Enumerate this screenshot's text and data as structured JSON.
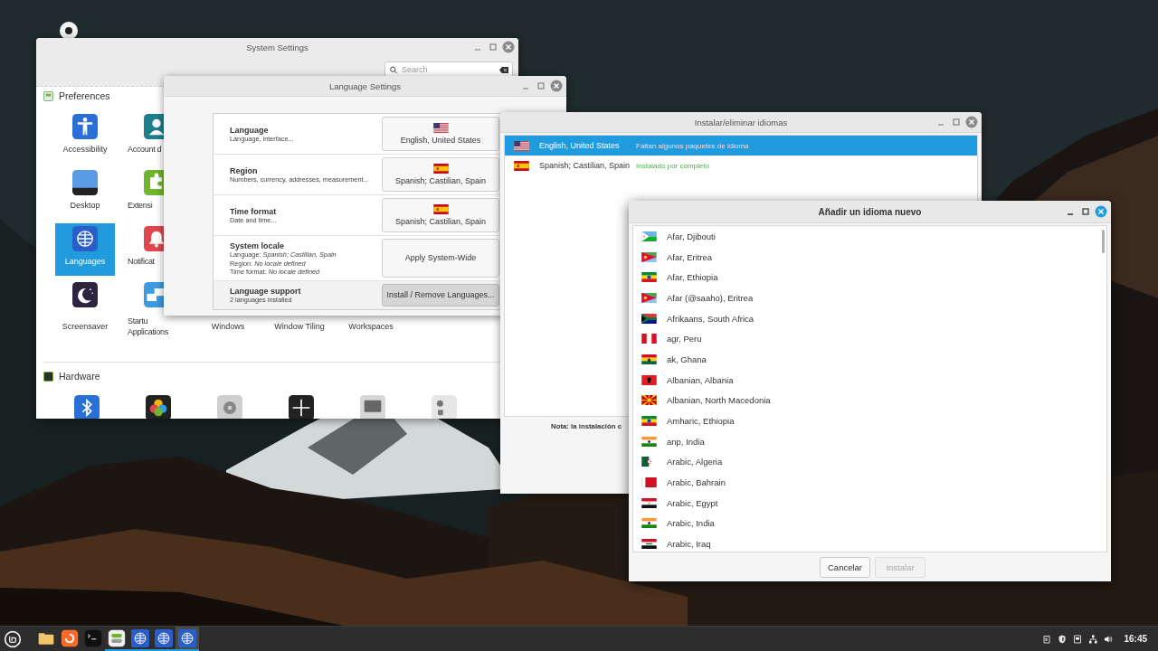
{
  "system_settings": {
    "title": "System Settings",
    "search": {
      "placeholder": "Search"
    },
    "sections": [
      {
        "title": "Preferences",
        "rows": [
          [
            {
              "label": "Accessibility",
              "selected": false,
              "clipped": false
            },
            {
              "label": "Account d",
              "selected": false,
              "clipped": true
            }
          ],
          [
            {
              "label": "Desktop",
              "selected": false,
              "clipped": false
            },
            {
              "label": "Extensi",
              "selected": false,
              "clipped": true
            }
          ],
          [
            {
              "label": "Languages",
              "selected": true,
              "clipped": false
            },
            {
              "label": "Notificat",
              "selected": false,
              "clipped": true
            }
          ],
          [
            {
              "label": "Screensaver",
              "selected": false,
              "clipped": false
            },
            {
              "label": "Startu Applications",
              "selected": false,
              "clipped": true
            },
            {
              "label": "Windows",
              "selected": false,
              "clipped": false
            },
            {
              "label": "Window Tiling",
              "selected": false,
              "clipped": false
            },
            {
              "label": "Workspaces",
              "selected": false,
              "clipped": false
            }
          ]
        ]
      },
      {
        "title": "Hardware"
      }
    ]
  },
  "language_settings": {
    "title": "Language Settings",
    "rows": [
      {
        "label": "Language",
        "description": [
          "Language, interface..."
        ],
        "button": {
          "label": "English, United States",
          "pressed": false
        }
      },
      {
        "label": "Region",
        "description": [
          "Numbers, currency, addresses, measurement..."
        ],
        "button": {
          "label": "Spanish; Castilian, Spain",
          "pressed": false
        }
      },
      {
        "label": "Time format",
        "description": [
          "Date and time..."
        ],
        "button": {
          "label": "Spanish; Castilian, Spain",
          "pressed": false
        }
      },
      {
        "label": "System locale",
        "description": [
          "Language: *Spanish; Castilian, Spain*",
          "Region: *No locale defined*",
          "Time format: *No locale defined*"
        ],
        "button": {
          "label": "Apply System-Wide",
          "pressed": false
        }
      },
      {
        "label": "Language support",
        "description": [
          "2 languages installed"
        ],
        "button": {
          "label": "Install / Remove Languages...",
          "pressed": true
        }
      }
    ]
  },
  "install_remove": {
    "title": "Instalar/eliminar idiomas",
    "languages": [
      {
        "name": "English, United States",
        "status": {
          "text": "Faltan algunos paquetes de idioma",
          "kind": "missing"
        },
        "selected": true
      },
      {
        "name": "Spanish; Castilian, Spain",
        "status": {
          "text": "Instalado por completo",
          "kind": "complete"
        },
        "selected": false
      }
    ],
    "note": "Nota: la instalación c"
  },
  "add_language": {
    "title": "Añadir un idioma nuevo",
    "languages": [
      "Afar, Djibouti",
      "Afar, Eritrea",
      "Afar, Ethiopia",
      "Afar (@saaho), Eritrea",
      "Afrikaans, South Africa",
      "agr, Peru",
      "ak, Ghana",
      "Albanian, Albania",
      "Albanian, North Macedonia",
      "Amharic, Ethiopia",
      "anp, India",
      "Arabic, Algeria",
      "Arabic, Bahrain",
      "Arabic, Egypt",
      "Arabic, India",
      "Arabic, Iraq"
    ],
    "buttons": [
      {
        "label": "Cancelar",
        "disabled": false
      },
      {
        "label": "Instalar",
        "disabled": true
      }
    ]
  },
  "taskbar": {
    "apps": [
      {
        "running": false,
        "selected": false
      },
      {
        "running": false,
        "selected": false
      },
      {
        "running": false,
        "selected": false
      },
      {
        "running": true,
        "selected": false
      },
      {
        "running": true,
        "selected": false
      },
      {
        "running": true,
        "selected": false
      },
      {
        "running": true,
        "selected": true
      }
    ],
    "clock": "16:45"
  }
}
